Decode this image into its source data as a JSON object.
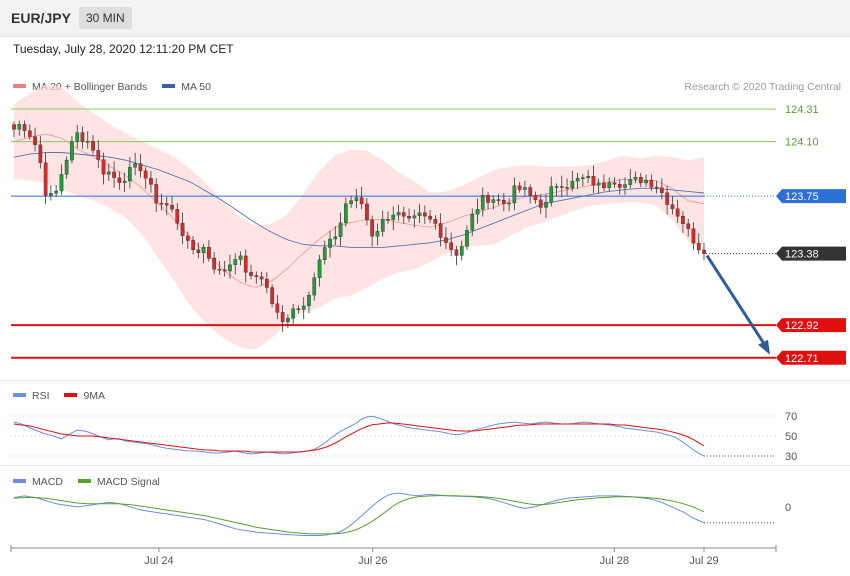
{
  "header": {
    "symbol": "EUR/JPY",
    "interval": "30 MIN"
  },
  "datetime": "Tuesday, July 28, 2020 12:11:20 PM CET",
  "legend_main": {
    "bb": "MA 20 + Bollinger Bands",
    "ma50": "MA 50"
  },
  "credit": "Research © 2020 Trading Central",
  "legend_rsi": {
    "rsi": "RSI",
    "ma9": "9MA"
  },
  "legend_macd": {
    "macd": "MACD",
    "signal": "MACD Signal"
  },
  "colors": {
    "bb_fill": "#ffd5d5",
    "bb_line": "#f08080",
    "ma50": "#3b5ea6",
    "up": "#1f9d3a",
    "down": "#d62b2b",
    "resistance": "#8fc85a",
    "support": "#e01010",
    "pivot": "#2c6fd6",
    "arrow": "#2f5d96",
    "rsi": "#6b8fe0",
    "rsi_ma": "#e01010",
    "macd": "#6b8fe0",
    "macd_signal": "#5aa02c"
  },
  "chart_data": [
    {
      "type": "candlestick",
      "title": "EUR/JPY 30 MIN",
      "x_ticks": [
        "Jul 24",
        "Jul 26",
        "Jul 28",
        "Jul 29"
      ],
      "ylim": [
        122.58,
        124.4
      ],
      "levels": [
        {
          "value": 124.31,
          "label": "124.31",
          "kind": "resistance"
        },
        {
          "value": 124.1,
          "label": "124.10",
          "kind": "resistance"
        },
        {
          "value": 123.75,
          "label": "123.75",
          "kind": "pivot"
        },
        {
          "value": 123.38,
          "label": "123.38",
          "kind": "last"
        },
        {
          "value": 122.92,
          "label": "122.92",
          "kind": "support"
        },
        {
          "value": 122.71,
          "label": "122.71",
          "kind": "support"
        }
      ],
      "close_anchors": [
        124.18,
        124.22,
        124.15,
        124.05,
        123.78,
        123.72,
        123.9,
        124.05,
        124.15,
        124.12,
        124.06,
        123.92,
        123.9,
        123.85,
        123.88,
        123.92,
        123.94,
        123.82,
        123.72,
        123.7,
        123.65,
        123.55,
        123.42,
        123.4,
        123.42,
        123.32,
        123.25,
        123.3,
        123.38,
        123.3,
        123.2,
        123.26,
        123.14,
        123.0,
        122.92,
        123.05,
        123.02,
        123.12,
        123.25,
        123.4,
        123.45,
        123.55,
        123.73,
        123.72,
        123.7,
        123.5,
        123.55,
        123.62,
        123.65,
        123.6,
        123.57,
        123.62,
        123.6,
        123.58,
        123.5,
        123.42,
        123.38,
        123.5,
        123.65,
        123.72,
        123.75,
        123.72,
        123.7,
        123.78,
        123.8,
        123.75,
        123.72,
        123.68,
        123.82,
        123.84,
        123.82,
        123.85,
        123.86,
        123.84,
        123.8,
        123.87,
        123.85,
        123.82,
        123.84,
        123.86,
        123.85,
        123.82,
        123.75,
        123.68,
        123.62,
        123.52,
        123.45,
        123.38
      ],
      "bb_mid_anchors": [
        124.1,
        124.13,
        124.15,
        124.12,
        124.05,
        124.0,
        123.94,
        123.88,
        123.8,
        123.7,
        123.6,
        123.48,
        123.38,
        123.28,
        123.2,
        123.16,
        123.2,
        123.28,
        123.38,
        123.47,
        123.55,
        123.58,
        123.6,
        123.6,
        123.58,
        123.56,
        123.55,
        123.58,
        123.62,
        123.65,
        123.68,
        123.72,
        123.75,
        123.76,
        123.78,
        123.8,
        123.82,
        123.84,
        123.86,
        123.85,
        123.85,
        123.8,
        123.72,
        123.7
      ],
      "bb_width_anchors": [
        0.24,
        0.28,
        0.32,
        0.33,
        0.3,
        0.28,
        0.27,
        0.27,
        0.3,
        0.35,
        0.4,
        0.44,
        0.45,
        0.44,
        0.42,
        0.4,
        0.37,
        0.35,
        0.38,
        0.44,
        0.46,
        0.47,
        0.44,
        0.38,
        0.32,
        0.28,
        0.22,
        0.2,
        0.2,
        0.22,
        0.24,
        0.22,
        0.2,
        0.18,
        0.16,
        0.14,
        0.13,
        0.14,
        0.15,
        0.14,
        0.16,
        0.2,
        0.26,
        0.3
      ],
      "ma50_anchors": [
        124.0,
        124.02,
        124.03,
        124.03,
        124.02,
        124.01,
        124.0,
        123.98,
        123.95,
        123.92,
        123.88,
        123.84,
        123.78,
        123.72,
        123.65,
        123.58,
        123.52,
        123.47,
        123.44,
        123.43,
        123.43,
        123.42,
        123.42,
        123.42,
        123.43,
        123.44,
        123.45,
        123.47,
        123.5,
        123.54,
        123.58,
        123.62,
        123.66,
        123.7,
        123.72,
        123.74,
        123.76,
        123.78,
        123.79,
        123.8,
        123.8,
        123.79,
        123.78,
        123.77
      ]
    },
    {
      "type": "line",
      "title": "RSI",
      "y_ticks": [
        70,
        50,
        30
      ],
      "ylim": [
        24,
        86
      ],
      "series": [
        {
          "name": "RSI",
          "values": [
            64,
            62,
            58,
            55,
            52,
            50,
            47,
            52,
            56,
            55,
            52,
            49,
            46,
            48,
            45,
            44,
            43,
            42,
            40,
            38,
            37,
            36,
            35,
            35,
            34,
            33,
            33,
            34,
            35,
            33,
            32,
            33,
            34,
            33,
            32,
            33,
            34,
            35,
            37,
            42,
            48,
            54,
            58,
            62,
            68,
            70,
            68,
            65,
            62,
            60,
            58,
            57,
            56,
            55,
            54,
            52,
            51,
            53,
            56,
            58,
            60,
            62,
            63,
            64,
            63,
            62,
            63,
            64,
            63,
            62,
            62,
            63,
            64,
            63,
            62,
            61,
            60,
            58,
            57,
            56,
            55,
            54,
            52,
            50,
            46,
            40,
            34,
            30
          ]
        },
        {
          "name": "9MA",
          "values": [
            62,
            61,
            60,
            58,
            56,
            54,
            52,
            51,
            50,
            50,
            50,
            49,
            48,
            47,
            46,
            45,
            44,
            43,
            42,
            41,
            40,
            39,
            38,
            37,
            36,
            36,
            35,
            35,
            35,
            35,
            34,
            34,
            34,
            34,
            34,
            34,
            34,
            35,
            36,
            38,
            41,
            45,
            50,
            54,
            58,
            61,
            62,
            63,
            63,
            62,
            61,
            60,
            59,
            58,
            57,
            56,
            55,
            55,
            55,
            56,
            57,
            58,
            59,
            60,
            61,
            61,
            62,
            62,
            62,
            62,
            62,
            62,
            62,
            62,
            62,
            62,
            61,
            61,
            60,
            59,
            58,
            57,
            56,
            54,
            52,
            49,
            45,
            40
          ]
        }
      ]
    },
    {
      "type": "line",
      "title": "MACD",
      "y_ticks": [
        0
      ],
      "ylim": [
        -0.24,
        0.12
      ],
      "series": [
        {
          "name": "MACD",
          "values": [
            0.06,
            0.07,
            0.06,
            0.04,
            0.02,
            0.01,
            0.0,
            0.01,
            0.02,
            0.03,
            0.02,
            0.0,
            -0.02,
            -0.03,
            -0.04,
            -0.05,
            -0.06,
            -0.07,
            -0.08,
            -0.1,
            -0.12,
            -0.14,
            -0.15,
            -0.16,
            -0.165,
            -0.17,
            -0.175,
            -0.18,
            -0.18,
            -0.18,
            -0.17,
            -0.15,
            -0.1,
            -0.04,
            0.02,
            0.07,
            0.09,
            0.08,
            0.07,
            0.08,
            0.075,
            0.07,
            0.068,
            0.065,
            0.06,
            0.05,
            0.03,
            0.01,
            -0.01,
            0.0,
            0.02,
            0.04,
            0.055,
            0.06,
            0.065,
            0.07,
            0.07,
            0.07,
            0.065,
            0.06,
            0.05,
            0.03,
            0.0,
            -0.03,
            -0.07,
            -0.1
          ]
        },
        {
          "name": "MACD Signal",
          "values": [
            0.055,
            0.06,
            0.06,
            0.055,
            0.045,
            0.035,
            0.025,
            0.02,
            0.02,
            0.02,
            0.02,
            0.015,
            0.005,
            -0.005,
            -0.015,
            -0.025,
            -0.035,
            -0.045,
            -0.055,
            -0.07,
            -0.085,
            -0.1,
            -0.115,
            -0.13,
            -0.14,
            -0.15,
            -0.16,
            -0.165,
            -0.17,
            -0.17,
            -0.17,
            -0.165,
            -0.15,
            -0.12,
            -0.08,
            -0.03,
            0.02,
            0.05,
            0.065,
            0.07,
            0.072,
            0.072,
            0.07,
            0.068,
            0.065,
            0.06,
            0.05,
            0.038,
            0.025,
            0.015,
            0.015,
            0.025,
            0.035,
            0.045,
            0.052,
            0.058,
            0.062,
            0.065,
            0.065,
            0.062,
            0.058,
            0.05,
            0.038,
            0.022,
            0.0,
            -0.03
          ]
        }
      ]
    }
  ]
}
